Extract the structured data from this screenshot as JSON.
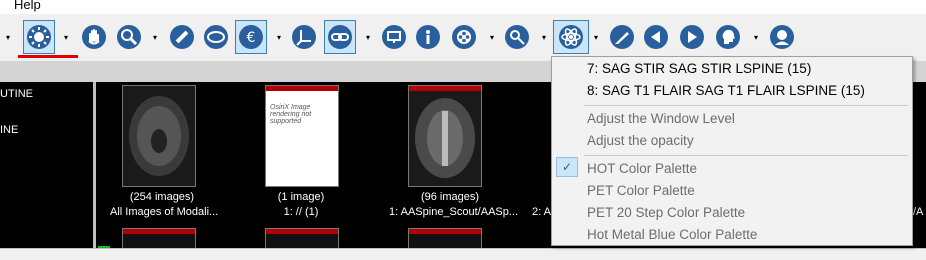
{
  "menubar": {
    "help_label": "Help"
  },
  "toolbar": {
    "buttons": [
      "window-level-icon",
      "pan-hand-icon",
      "zoom-icon",
      "ruler-icon",
      "oval-roi-icon",
      "euro-rotate-icon",
      "axes-icon",
      "link-icon",
      "display-icon",
      "info-icon",
      "movie-reel-icon",
      "magic-wand-icon",
      "atom-3d-icon",
      "scalpel-icon",
      "previous-arrow-icon",
      "next-arrow-icon",
      "head-profile-icon",
      "head-front-icon"
    ]
  },
  "series_list": {
    "items": [
      "UTINE",
      "INE"
    ]
  },
  "thumbnails": [
    {
      "count": "(254 images)",
      "label": "All Images of Modali..."
    },
    {
      "count": "(1 image)",
      "label": "1: // (1)",
      "image_text": "OsiriX Image rendering not supported"
    },
    {
      "count": "(96 images)",
      "label": "1: AASpine_Scout/AASp..."
    }
  ],
  "thumbnail_partial_label": "2: A",
  "thumbnail_partial_right": "/A",
  "context_menu": {
    "items": [
      {
        "label": "7: SAG STIR SAG STIR LSPINE (15)",
        "enabled": true
      },
      {
        "label": "8: SAG T1 FLAIR SAG T1 FLAIR LSPINE (15)",
        "enabled": true
      },
      {
        "label": "Adjust the Window Level",
        "enabled": false
      },
      {
        "label": "Adjust the opacity",
        "enabled": false
      },
      {
        "label": "HOT Color Palette",
        "enabled": false,
        "checked": true
      },
      {
        "label": "PET Color Palette",
        "enabled": false
      },
      {
        "label": "PET 20 Step Color Palette",
        "enabled": false
      },
      {
        "label": "Hot Metal Blue Color Palette",
        "enabled": false
      }
    ]
  },
  "colors": {
    "accent": "#3c7fb1",
    "selected_bg": "#cce4f7",
    "underline": "#e00000"
  }
}
